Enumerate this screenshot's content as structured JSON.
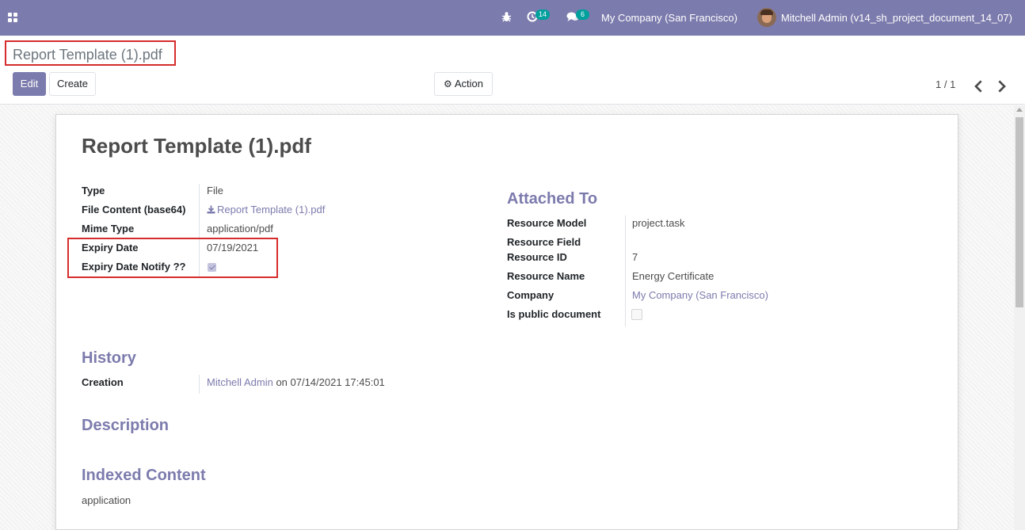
{
  "navbar": {
    "activity_count": "14",
    "messages_count": "6",
    "company": "My Company (San Francisco)",
    "user": "Mitchell Admin (v14_sh_project_document_14_07)"
  },
  "control_panel": {
    "breadcrumb": "Report Template (1).pdf",
    "edit_label": "Edit",
    "create_label": "Create",
    "action_label": "Action",
    "pager": "1 / 1"
  },
  "record": {
    "title": "Report Template (1).pdf",
    "left_fields": [
      {
        "label": "Type",
        "value": "File"
      },
      {
        "label": "File Content (base64)",
        "value": "Report Template (1).pdf"
      },
      {
        "label": "Mime Type",
        "value": "application/pdf"
      },
      {
        "label": "Expiry Date",
        "value": "07/19/2021"
      },
      {
        "label": "Expiry Date Notify ??",
        "checked": true
      }
    ],
    "attached_to": {
      "heading": "Attached To",
      "fields": [
        {
          "label": "Resource Model",
          "value": "project.task"
        },
        {
          "label": "Resource Field",
          "value": ""
        },
        {
          "label": "Resource ID",
          "value": "7"
        },
        {
          "label": "Resource Name",
          "value": "Energy Certificate"
        },
        {
          "label": "Company",
          "value": "My Company (San Francisco)"
        },
        {
          "label": "Is public document",
          "checked": false
        }
      ]
    },
    "history": {
      "heading": "History",
      "creation_label": "Creation",
      "creation_user": "Mitchell Admin",
      "creation_date": "on 07/14/2021 17:45:01"
    },
    "description": {
      "heading": "Description"
    },
    "indexed_content": {
      "heading": "Indexed Content",
      "value": "application"
    }
  },
  "colors": {
    "brand": "#7c7bad",
    "badge": "#00a09d",
    "highlight": "#d62c2c"
  }
}
